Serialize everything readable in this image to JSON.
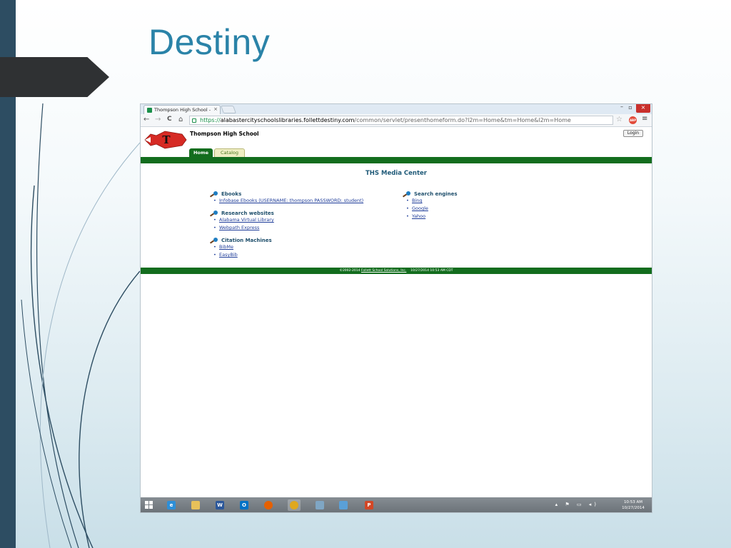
{
  "slide": {
    "title": "Destiny",
    "colors": {
      "accent": "#2a83a8",
      "sidebar": "#2d4d62",
      "arrow": "#2f3133"
    }
  },
  "browser": {
    "tab_title": "Thompson High School -",
    "tab_close": "×",
    "window_controls": {
      "minimize": "–",
      "maximize": "▫",
      "close": "×"
    },
    "nav": {
      "back": "←",
      "forward": "→",
      "reload": "C",
      "home": "⌂"
    },
    "url_scheme": "https://",
    "url_host": "alabastercityschoolslibraries.follettdestiny.com",
    "url_path": "/common/servlet/presenthomeform.do?l2m=Home&tm=Home&l2m=Home",
    "star": "☆",
    "adblock_label": "ABP",
    "menu": "≡"
  },
  "page": {
    "school_name": "Thompson High School",
    "logo_letter": "T",
    "login_label": "Login",
    "tabs": {
      "home": "Home",
      "catalog": "Catalog"
    },
    "center_title": "THS Media Center",
    "left_sections": [
      {
        "heading": "Ebooks",
        "links": [
          "Infobase Ebooks (USERNAME: thompson PASSWORD: student)"
        ]
      },
      {
        "heading": "Research websites",
        "links": [
          "Alabama Virtual Library",
          "Webpath Express"
        ]
      },
      {
        "heading": "Citation Machines",
        "links": [
          "BibMe",
          "EasyBib"
        ]
      }
    ],
    "right_sections": [
      {
        "heading": "Search engines",
        "links": [
          "Bing",
          "Google",
          "Yahoo"
        ]
      }
    ],
    "footer_copyright": "©2002-2014",
    "footer_company": "Follett School Solutions, Inc.",
    "footer_timestamp": "10/27/2014 10:53 AM CDT",
    "colors": {
      "green": "#136d1e",
      "link": "#1e3c99",
      "heading": "#1f4f6c"
    }
  },
  "taskbar": {
    "apps": [
      {
        "name": "internet-explorer",
        "label": "e",
        "color": "#2d8fd8"
      },
      {
        "name": "file-explorer",
        "label": "",
        "color": "#e8c15a"
      },
      {
        "name": "word",
        "label": "W",
        "color": "#2b579a"
      },
      {
        "name": "outlook",
        "label": "O",
        "color": "#0072c6"
      },
      {
        "name": "firefox",
        "label": "",
        "color": "#e66000"
      },
      {
        "name": "chrome",
        "label": "",
        "color": "#e0a81e",
        "active": true
      },
      {
        "name": "calculator",
        "label": "",
        "color": "#7fa6c4"
      },
      {
        "name": "network-app",
        "label": "",
        "color": "#5aa0d8"
      },
      {
        "name": "powerpoint",
        "label": "P",
        "color": "#d24726"
      }
    ],
    "tray_icons": "▴ ⚑ ▭ ◂)",
    "time": "10:53 AM",
    "date": "10/27/2014"
  }
}
